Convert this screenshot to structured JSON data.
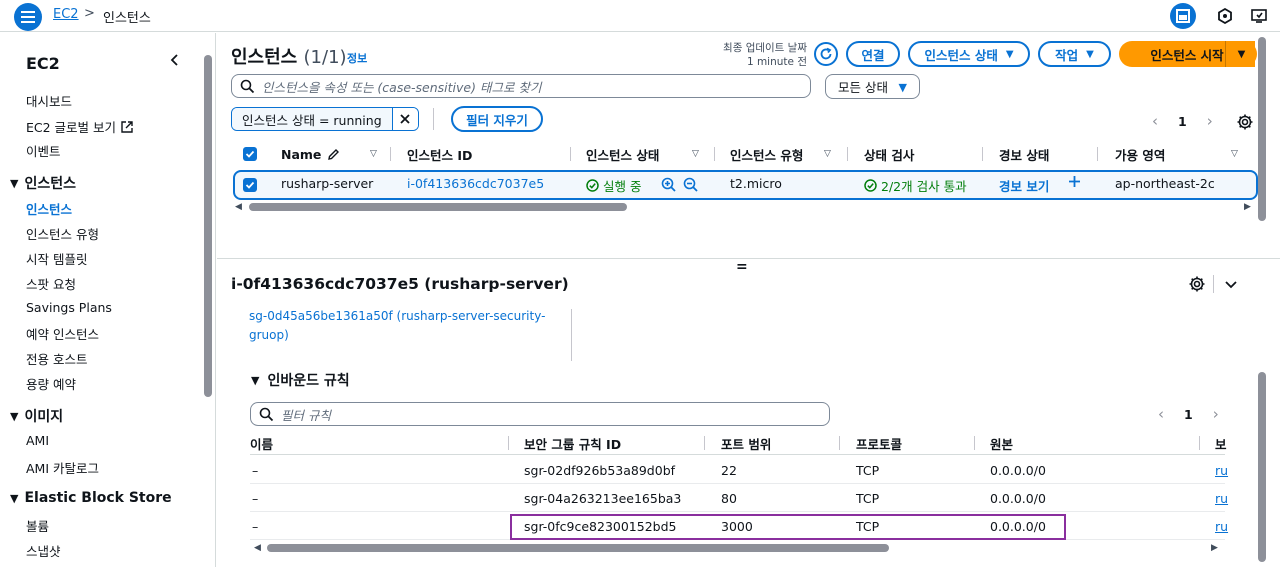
{
  "topbar": {
    "breadcrumb_root": "EC2",
    "breadcrumb_sep": ">",
    "breadcrumb_current": "인스턴스"
  },
  "leftnav": {
    "title": "EC2",
    "items_top": [
      "대시보드",
      "EC2 글로벌 보기",
      "이벤트"
    ],
    "section_instances": "인스턴스",
    "instances_items": [
      "인스턴스",
      "인스턴스 유형",
      "시작 템플릿",
      "스팟 요청",
      "Savings Plans",
      "예약 인스턴스",
      "전용 호스트",
      "용량 예약"
    ],
    "section_images": "이미지",
    "images_items": [
      "AMI",
      "AMI 카탈로그"
    ],
    "section_ebs": "Elastic Block Store",
    "ebs_items": [
      "볼륨",
      "스냅샷"
    ]
  },
  "header": {
    "title": "인스턴스",
    "count": "(1/1)",
    "info": "정보",
    "last_updated_label": "최종 업데이트 날짜",
    "last_updated_value": "1 minute 전",
    "connect": "연결",
    "instance_state": "인스턴스 상태",
    "actions": "작업",
    "launch": "인스턴스 시작"
  },
  "search": {
    "placeholder": "인스턴스을 속성 또는 (case-sensitive) 태그로 찾기",
    "status_filter": "모든 상태"
  },
  "filter": {
    "token": "인스턴스 상태 = running",
    "clear": "필터 지우기"
  },
  "pagination": {
    "page": "1"
  },
  "table": {
    "columns": [
      "Name",
      "인스턴스 ID",
      "인스턴스 상태",
      "인스턴스 유형",
      "상태 검사",
      "경보 상태",
      "가용 영역"
    ],
    "row": {
      "name": "rusharp-server",
      "instance_id": "i-0f413636cdc7037e5",
      "state": "실행 중",
      "type": "t2.micro",
      "status_check": "2/2개 검사 통과",
      "alarm": "경보 보기",
      "az": "ap-northeast-2c"
    }
  },
  "detail": {
    "title": "i-0f413636cdc7037e5 (rusharp-server)",
    "security_group": "sg-0d45a56be1361a50f (rusharp-server-security-gruop)",
    "inbound_title": "인바운드 규칙",
    "rules_filter_placeholder": "필터 규칙",
    "rules_page": "1",
    "rules_columns": [
      "이름",
      "보안 그룹 규칙 ID",
      "포트 범위",
      "프로토콜",
      "원본",
      "보"
    ],
    "rules": [
      {
        "name": "–",
        "id": "sgr-02df926b53a89d0bf",
        "port": "22",
        "protocol": "TCP",
        "source": "0.0.0.0/0",
        "extra": "ru"
      },
      {
        "name": "–",
        "id": "sgr-04a263213ee165ba3",
        "port": "80",
        "protocol": "TCP",
        "source": "0.0.0.0/0",
        "extra": "ru"
      },
      {
        "name": "–",
        "id": "sgr-0fc9ce82300152bd5",
        "port": "3000",
        "protocol": "TCP",
        "source": "0.0.0.0/0",
        "extra": "ru"
      }
    ]
  },
  "colors": {
    "accent": "#0972d3",
    "primary": "#ff9900",
    "success": "#037f0c",
    "highlight": "#8a2f9e"
  }
}
